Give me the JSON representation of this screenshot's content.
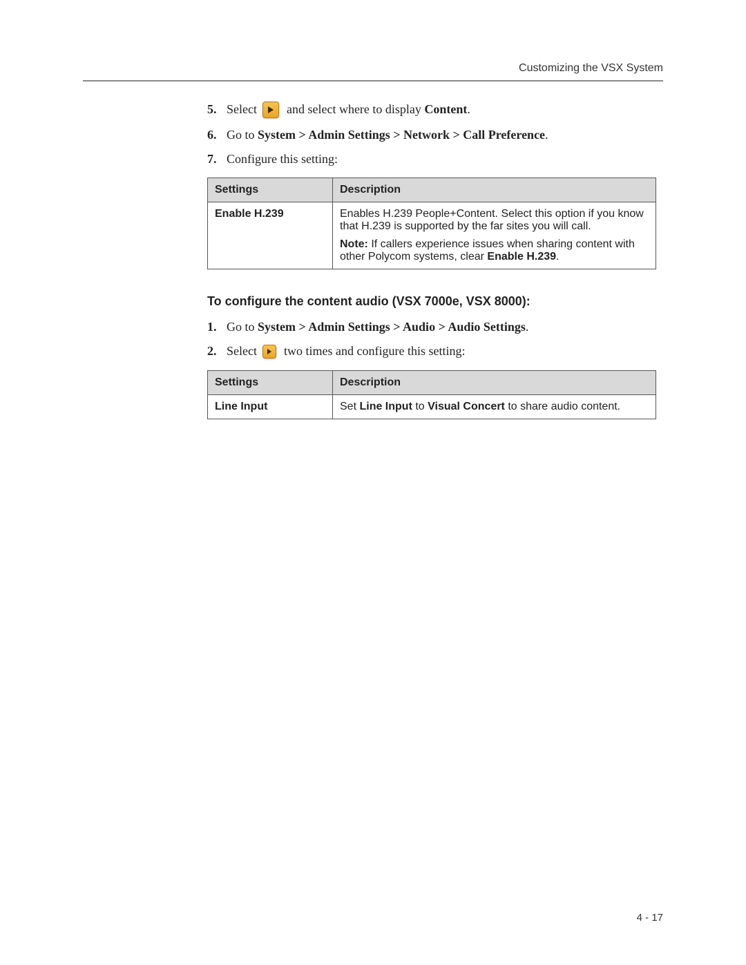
{
  "header": "Customizing the VSX System",
  "stepsA": {
    "s5": {
      "num": "5.",
      "pre": "Select ",
      "post_pre": " and select where to display ",
      "post_bold": "Content",
      "post_suffix": "."
    },
    "s6": {
      "num": "6.",
      "pre": "Go to ",
      "bold": "System > Admin Settings > Network > Call Preference",
      "post": "."
    },
    "s7": {
      "num": "7.",
      "text": "Configure this setting:"
    }
  },
  "tableA": {
    "h1": "Settings",
    "h2": "Description",
    "r1_setting": "Enable H.239",
    "r1_desc_p1": "Enables H.239 People+Content. Select this option if you know that H.239 is supported by the far sites you will call.",
    "r1_desc_note_label": "Note:",
    "r1_desc_note_text": " If callers experience issues when sharing content with other Polycom systems, clear ",
    "r1_desc_note_bold": "Enable H.239",
    "r1_desc_note_suffix": "."
  },
  "sectionB_title": "To configure the content audio (VSX 7000e, VSX 8000):",
  "stepsB": {
    "s1": {
      "num": "1.",
      "pre": "Go to ",
      "bold": "System > Admin Settings > Audio > Audio Settings",
      "post": "."
    },
    "s2": {
      "num": "2.",
      "pre": "Select ",
      "post": " two times and configure this setting:"
    }
  },
  "tableB": {
    "h1": "Settings",
    "h2": "Description",
    "r1_setting": "Line Input",
    "r1_pre": "Set ",
    "r1_b1": "Line Input",
    "r1_mid": " to ",
    "r1_b2": "Visual Concert",
    "r1_post": " to share audio content."
  },
  "footer": "4 - 17"
}
